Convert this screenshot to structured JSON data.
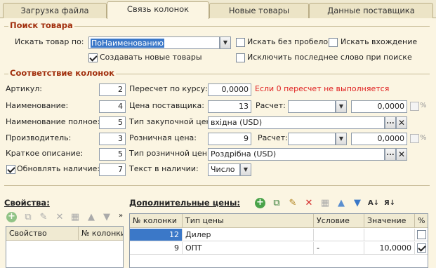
{
  "tabs": [
    "Загрузка файла",
    "Связь колонок",
    "Новые товары",
    "Данные поставщика"
  ],
  "search": {
    "title": "Поиск товара",
    "search_by_label": "Искать товар по:",
    "search_by_value": "ПоНаименованию",
    "no_spaces_label": "Искать без пробелов",
    "occurrence_label": "Искать вхождение",
    "create_new_label": "Создавать новые товары",
    "exclude_last_word_label": "Исключить последнее слово при поиске"
  },
  "mapping": {
    "title": "Соответствие колонок",
    "article_label": "Артикул:",
    "article_value": "2",
    "name_label": "Наименование:",
    "name_value": "4",
    "full_name_label": "Наименование полное:",
    "full_name_value": "5",
    "manufacturer_label": "Производитель:",
    "manufacturer_value": "3",
    "short_desc_label": "Краткое описание:",
    "short_desc_value": "5",
    "update_avail_label": "Обновлять наличие:",
    "update_avail_value": "7",
    "rate_label": "Пересчет по курсу:",
    "rate_value": "0,0000",
    "rate_note": "Если 0 пересчет не выполняется",
    "supplier_price_label": "Цена поставщика:",
    "supplier_price_value": "13",
    "calc1_label": "Расчет:",
    "calc1_value": "",
    "calc1_amount": "0,0000",
    "purchase_type_label": "Тип закупочной цены:",
    "purchase_type_value": "вхідна (USD)",
    "retail_price_label": "Розничная цена:",
    "retail_price_value": "9",
    "calc2_label": "Расчет:",
    "calc2_value": "",
    "calc2_amount": "0,0000",
    "retail_type_label": "Тип розничной цены:",
    "retail_type_value": "Роздрібна (USD)",
    "avail_text_label": "Текст в наличии:",
    "avail_text_value": "Число",
    "percent": "%"
  },
  "properties": {
    "title": "Свойства:",
    "columns": [
      "Свойство",
      "№ колонки"
    ]
  },
  "extra_prices": {
    "title": "Дополнительные цены:",
    "columns": [
      "№ колонки",
      "Тип цены",
      "Условие",
      "Значение",
      "%"
    ],
    "rows": [
      {
        "col": "12",
        "type": "Дилер",
        "cond": "",
        "value": "",
        "pct": false
      },
      {
        "col": "9",
        "type": "ОПТ",
        "cond": "-",
        "value": "10,0000",
        "pct": true
      }
    ]
  },
  "icons": [
    "add-icon",
    "copy-icon",
    "edit-icon",
    "delete-icon",
    "end-edit-icon",
    "move-up-icon",
    "move-down-icon",
    "sort-asc-icon",
    "sort-desc-icon",
    "more-icon"
  ]
}
